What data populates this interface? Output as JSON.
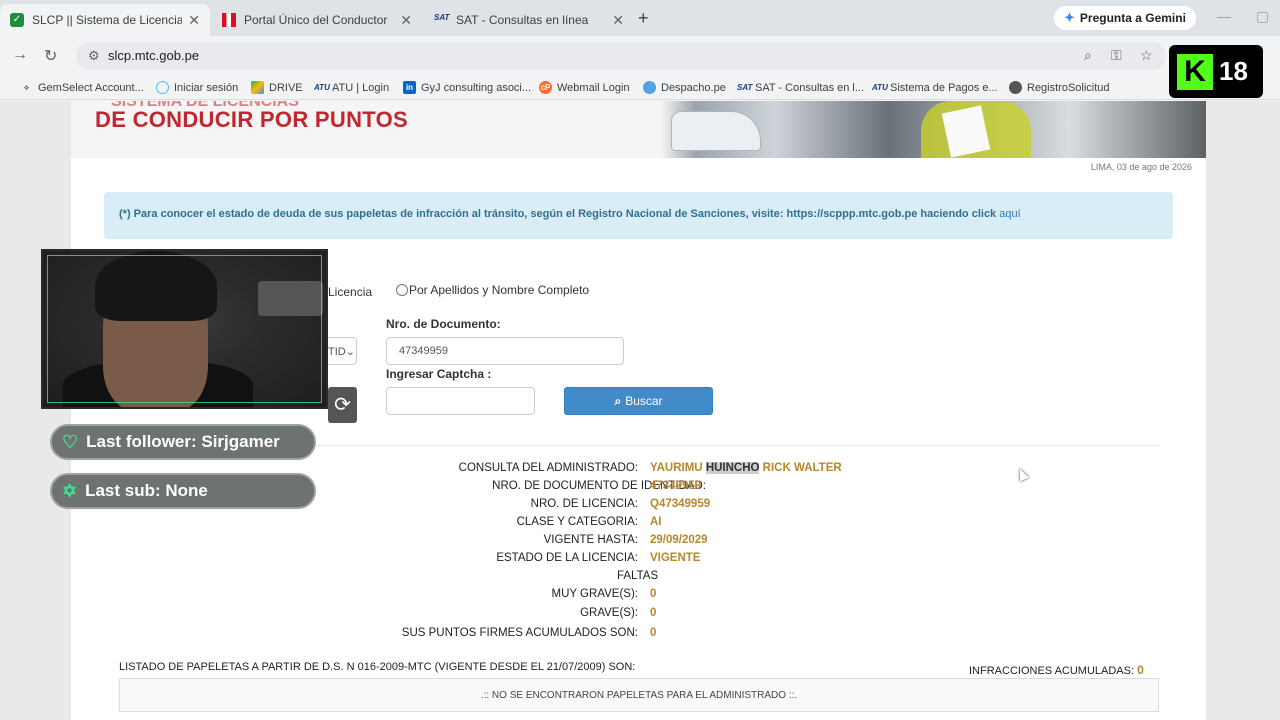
{
  "tabs": [
    {
      "title": "SLCP || Sistema de Licencias de",
      "close": "✕"
    },
    {
      "title": "Portal Único del Conductor",
      "close": "✕"
    },
    {
      "title": "SAT - Consultas en línea",
      "close": "✕"
    }
  ],
  "new_tab": "+",
  "gemini": {
    "label": "Pregunta a Gemini",
    "icon": "gemini-spark-icon"
  },
  "address": {
    "url": "slcp.mtc.gob.pe"
  },
  "bookmarks": [
    {
      "label": "GemSelect Account...",
      "icon": "gem-icon"
    },
    {
      "label": "Iniciar sesión",
      "icon": "login-icon"
    },
    {
      "label": "DRIVE",
      "icon": "drive-icon"
    },
    {
      "label": "ATU | Login",
      "icon": "atu-icon"
    },
    {
      "label": "GyJ consulting asoci...",
      "icon": "linkedin-icon"
    },
    {
      "label": "Webmail Login",
      "icon": "cpanel-icon"
    },
    {
      "label": "Despacho.pe",
      "icon": "globe-icon"
    },
    {
      "label": "SAT - Consultas en l...",
      "icon": "sat-icon"
    },
    {
      "label": "Sistema de Pagos e...",
      "icon": "atu-icon"
    },
    {
      "label": "RegistroSolicitud",
      "icon": "globe-icon"
    }
  ],
  "banner": {
    "line1": "SISTEMA DE LICENCIAS",
    "line2": "DE CONDUCIR POR PUNTOS"
  },
  "date": "LIMA, 03 de ago de 2026",
  "notice": {
    "text": "(*) Para conocer el estado de deuda de sus papeletas de infracción al tránsito, según el Registro Nacional de Sanciones, visite: https://scppp.mtc.gob.pe haciendo click ",
    "link": "aquí"
  },
  "search": {
    "radio_licencia": "Licencia",
    "radio_nombre": "Por Apellidos y Nombre Completo",
    "doc_type_stub": "TID",
    "doc_label": "Nro. de Documento:",
    "doc_value": "47349959",
    "captcha_label": "Ingresar Captcha :",
    "captcha_value": "",
    "search_button": "Buscar"
  },
  "result": {
    "rows": [
      {
        "label": "CONSULTA DEL ADMINISTRADO:",
        "pre": "YAURIMU ",
        "hl": "HUINCHO",
        "post": " RICK WALTER"
      },
      {
        "label": "NRO. DE DOCUMENTO DE IDENTIDAD:",
        "value": "47349959"
      },
      {
        "label": "NRO. DE LICENCIA:",
        "value": "Q47349959"
      },
      {
        "label": "CLASE Y CATEGORIA:",
        "value": "AI"
      },
      {
        "label": "VIGENTE HASTA:",
        "value": "29/09/2029"
      },
      {
        "label": "ESTADO DE LA LICENCIA:",
        "value": "VIGENTE"
      }
    ],
    "faltas_title": "FALTAS",
    "faltas": [
      {
        "label": "MUY GRAVE(S):",
        "value": "0"
      },
      {
        "label": "GRAVE(S):",
        "value": "0"
      },
      {
        "label": "SUS PUNTOS FIRMES ACUMULADOS SON:",
        "value": "0"
      }
    ],
    "listado": "LISTADO DE PAPELETAS A PARTIR DE D.S. N 016-2009-MTC (VIGENTE DESDE EL 21/07/2009) SON:",
    "infracciones_label": "INFRACCIONES ACUMULADAS:",
    "infracciones_value": "0",
    "no_papeletas": ".:: NO SE ENCONTRARON PAPELETAS PARA EL ADMINISTRADO ::."
  },
  "overlay": {
    "last_follower": "Last follower: Sirjgamer",
    "last_sub": "Last sub: None",
    "kick_badge": "18"
  }
}
